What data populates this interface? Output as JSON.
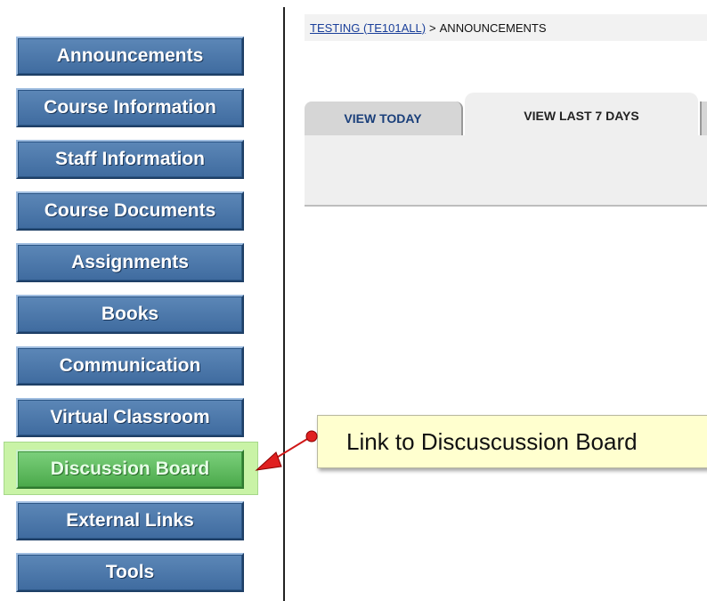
{
  "breadcrumb": {
    "course_link": "TESTING (TE101ALL)",
    "separator": ">",
    "current": "ANNOUNCEMENTS"
  },
  "tabs": [
    {
      "label": "VIEW TODAY",
      "state": "inactive"
    },
    {
      "label": "VIEW LAST 7 DAYS",
      "state": "active"
    }
  ],
  "sidebar": {
    "items": [
      {
        "label": "Announcements"
      },
      {
        "label": "Course Information"
      },
      {
        "label": "Staff Information"
      },
      {
        "label": "Course Documents"
      },
      {
        "label": "Assignments"
      },
      {
        "label": "Books"
      },
      {
        "label": "Communication"
      },
      {
        "label": "Virtual Classroom"
      },
      {
        "label": "Discussion Board",
        "highlighted": true
      },
      {
        "label": "External Links"
      },
      {
        "label": "Tools"
      }
    ]
  },
  "callout": {
    "text": "Link to Discuscussion Board"
  },
  "colors": {
    "nav_button": "#4a76a8",
    "nav_highlight": "#5cbb5c",
    "callout_bg": "#ffffcf",
    "pointer": "#e02020"
  }
}
